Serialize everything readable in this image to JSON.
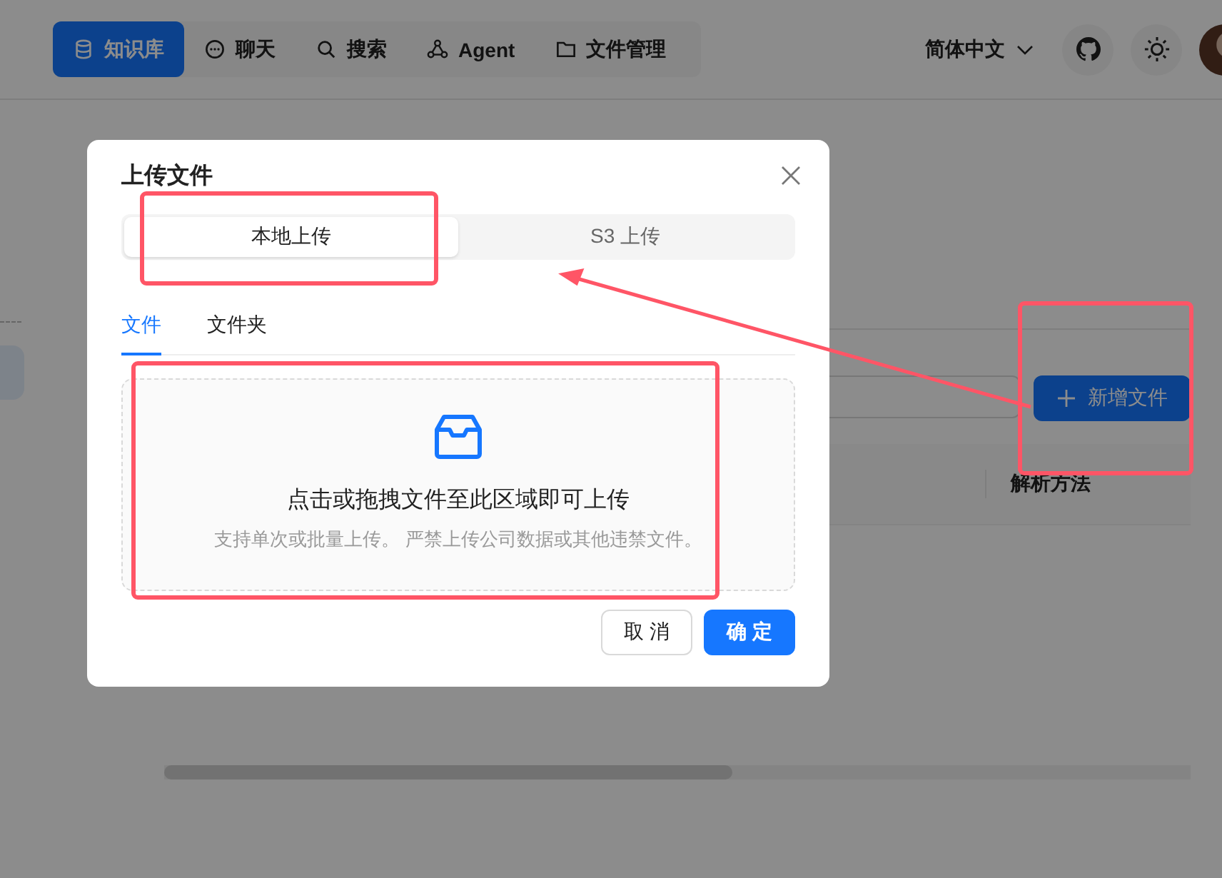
{
  "nav": {
    "items": [
      {
        "label": "知识库",
        "selected": true
      },
      {
        "label": "聊天",
        "selected": false
      },
      {
        "label": "搜索",
        "selected": false
      },
      {
        "label": "Agent",
        "selected": false
      },
      {
        "label": "文件管理",
        "selected": false
      }
    ]
  },
  "language": "简体中文",
  "toolbar": {
    "add_button": "新增文件"
  },
  "table": {
    "columns": [
      "解析方法"
    ]
  },
  "modal": {
    "title": "上传文件",
    "source_options": [
      {
        "label": "本地上传",
        "selected": true
      },
      {
        "label": "S3 上传",
        "selected": false
      }
    ],
    "tabs": [
      {
        "label": "文件",
        "selected": true
      },
      {
        "label": "文件夹",
        "selected": false
      }
    ],
    "dropzone": {
      "text": "点击或拖拽文件至此区域即可上传",
      "hint": "支持单次或批量上传。 严禁上传公司数据或其他违禁文件。"
    },
    "buttons": [
      {
        "label": "取 消",
        "kind": "default"
      },
      {
        "label": "确 定",
        "kind": "primary"
      }
    ]
  }
}
